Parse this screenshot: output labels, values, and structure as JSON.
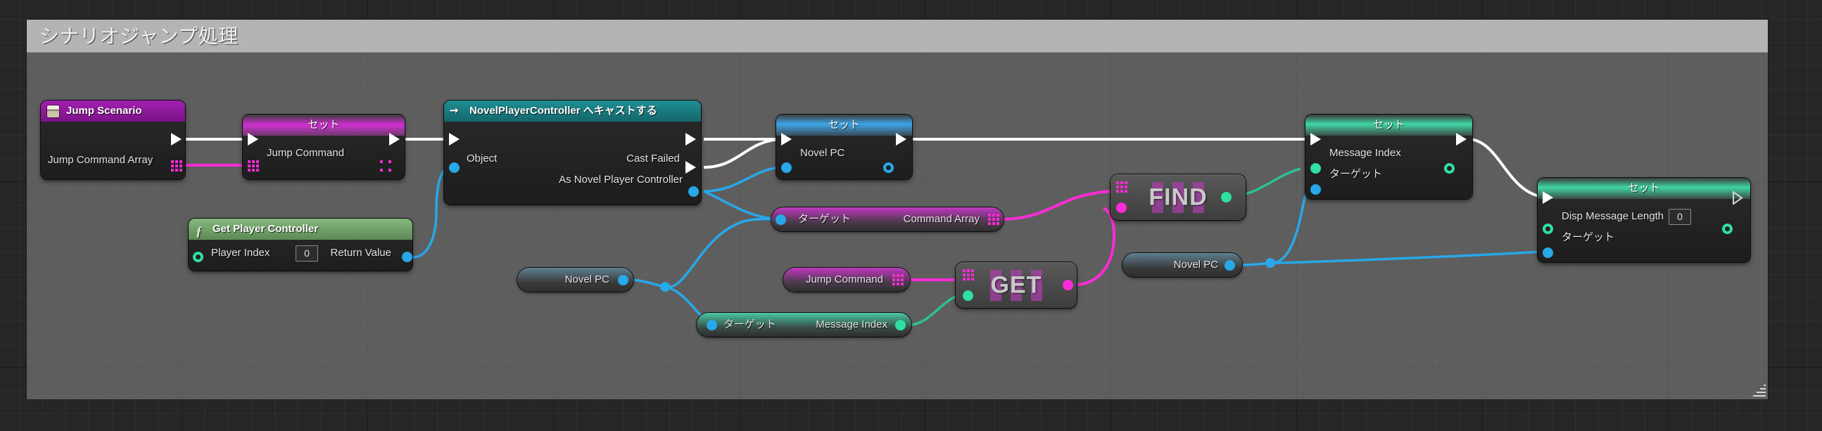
{
  "editor": {
    "type": "unreal-blueprint-graph",
    "background_color": "#262626",
    "grid": true
  },
  "comment": {
    "title": "シナリオジャンプ処理",
    "bar_color": "#b4b4b4",
    "fill_color": "rgba(145,145,145,.52)"
  },
  "colors": {
    "exec_white": "#ffffff",
    "object_blue": "#28a8e8",
    "array_pink": "#ff2bd6",
    "int_green": "#2fe0a0",
    "event_purple": "#a21fb0",
    "cast_teal": "#1f8f94",
    "function_green": "#86b87d"
  },
  "nodes": {
    "event_jump_scenario": {
      "title": "Jump Scenario",
      "icon": "event-icon",
      "output_pin": "Jump Command Array"
    },
    "set_jump_command": {
      "title": "セット",
      "input_pin": "Jump Command"
    },
    "cast_novel_player_controller": {
      "title": "NovelPlayerController へキャストする",
      "icon": "cast-icon",
      "input_pin": "Object",
      "output_exec_fail": "Cast Failed",
      "output_pin": "As Novel Player Controller"
    },
    "get_player_controller": {
      "title": "Get Player Controller",
      "icon": "function-icon",
      "input_pin": "Player Index",
      "input_value": "0",
      "output_pin": "Return Value"
    },
    "set_novel_pc": {
      "title": "セット",
      "input_pin": "Novel PC"
    },
    "get_novel_pc_1": {
      "label": "Novel PC"
    },
    "get_novel_pc_2": {
      "label": "Novel PC"
    },
    "get_command_array": {
      "target_pin": "ターゲット",
      "output_pin": "Command Array"
    },
    "get_jump_command": {
      "label": "Jump Command"
    },
    "get_message_index": {
      "target_pin": "ターゲット",
      "output_pin": "Message Index"
    },
    "array_get": {
      "label": "GET"
    },
    "array_find": {
      "label": "FIND"
    },
    "set_message_index": {
      "title": "セット",
      "input_pin_1": "Message Index",
      "input_pin_2": "ターゲット"
    },
    "set_disp_message_length": {
      "title": "セット",
      "input_pin_1": "Disp Message Length",
      "input_value": "0",
      "input_pin_2": "ターゲット"
    }
  }
}
